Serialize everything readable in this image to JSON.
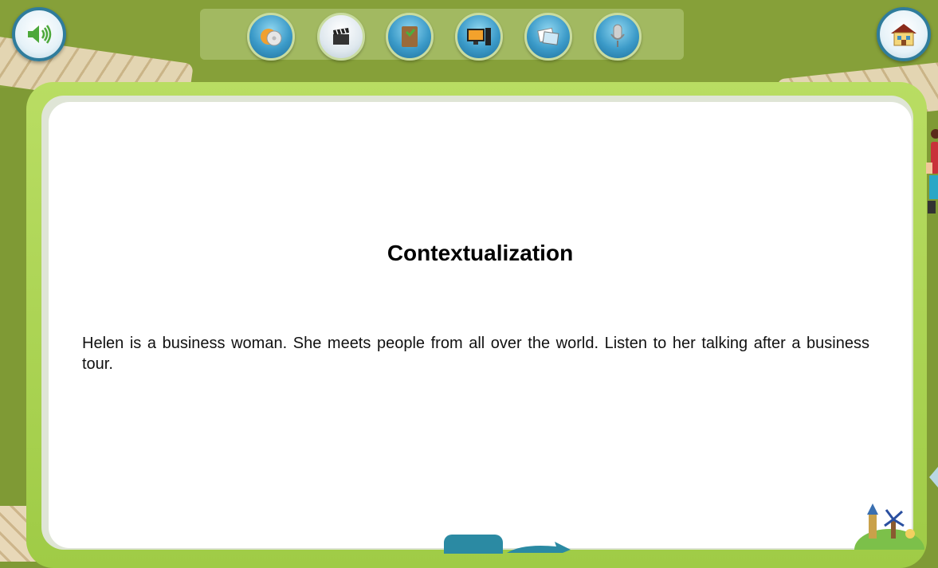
{
  "toolbar": {
    "tools": [
      {
        "icon": "disc-icon"
      },
      {
        "icon": "clapperboard-icon"
      },
      {
        "icon": "book-icon"
      },
      {
        "icon": "computer-icon"
      },
      {
        "icon": "photos-icon"
      },
      {
        "icon": "microphone-icon"
      }
    ]
  },
  "header": {
    "sound_icon": "speaker-icon",
    "home_icon": "home-icon"
  },
  "content": {
    "title": "Contextualization",
    "paragraph": "Helen is a business woman. She meets people from all over the world. Listen to her talking after a business tour."
  },
  "colors": {
    "background": "#7f9a35",
    "frame": "#a6cf4b",
    "button_border": "#2f7c9c",
    "tool_button": "#3b9ac8"
  }
}
